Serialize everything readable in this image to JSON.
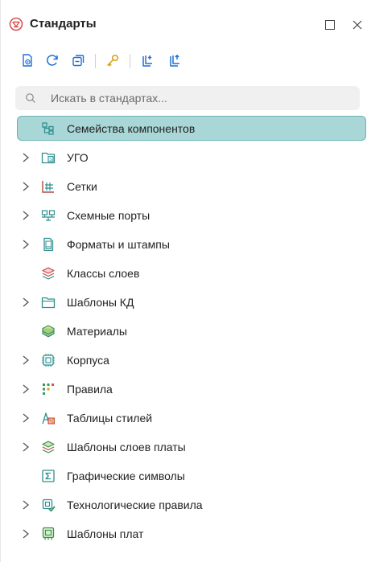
{
  "header": {
    "title": "Стандарты",
    "brand_icon": "standards-logo-icon",
    "buttons": {
      "maximize": "maximize-icon",
      "close": "close-icon"
    }
  },
  "toolbar": {
    "buttons": [
      "new-document-icon",
      "refresh-icon",
      "collapse-all-icon",
      "key-icon",
      "import-icon",
      "export-icon"
    ]
  },
  "search": {
    "placeholder": "Искать в стандартах...",
    "value": ""
  },
  "tree": {
    "items": [
      {
        "label": "Семейства компонентов",
        "icon": "component-families-icon",
        "expandable": false,
        "selected": true
      },
      {
        "label": "УГО",
        "icon": "folder-symbol-icon",
        "expandable": true
      },
      {
        "label": "Сетки",
        "icon": "grid-icon",
        "expandable": true
      },
      {
        "label": "Схемные порты",
        "icon": "schematic-ports-icon",
        "expandable": true
      },
      {
        "label": "Форматы и штампы",
        "icon": "sheet-format-icon",
        "expandable": true
      },
      {
        "label": "Классы слоев",
        "icon": "layer-classes-icon",
        "expandable": false
      },
      {
        "label": "Шаблоны КД",
        "icon": "folder-icon",
        "expandable": true
      },
      {
        "label": "Материалы",
        "icon": "materials-icon",
        "expandable": false
      },
      {
        "label": "Корпуса",
        "icon": "package-icon",
        "expandable": true
      },
      {
        "label": "Правила",
        "icon": "rules-icon",
        "expandable": true
      },
      {
        "label": "Таблицы стилей",
        "icon": "style-tables-icon",
        "expandable": true
      },
      {
        "label": "Шаблоны слоев платы",
        "icon": "board-layers-icon",
        "expandable": true
      },
      {
        "label": "Графические символы",
        "icon": "sigma-symbol-icon",
        "expandable": false
      },
      {
        "label": "Технологические правила",
        "icon": "tech-rules-icon",
        "expandable": true
      },
      {
        "label": "Шаблоны плат",
        "icon": "board-template-icon",
        "expandable": true
      }
    ]
  },
  "colors": {
    "selection_bg": "#a9d6d6",
    "selection_border": "#6cb4b4",
    "brand_red": "#d9534f",
    "toolbar_blue": "#1e6fd9",
    "icon_teal": "#2f8f8f"
  }
}
